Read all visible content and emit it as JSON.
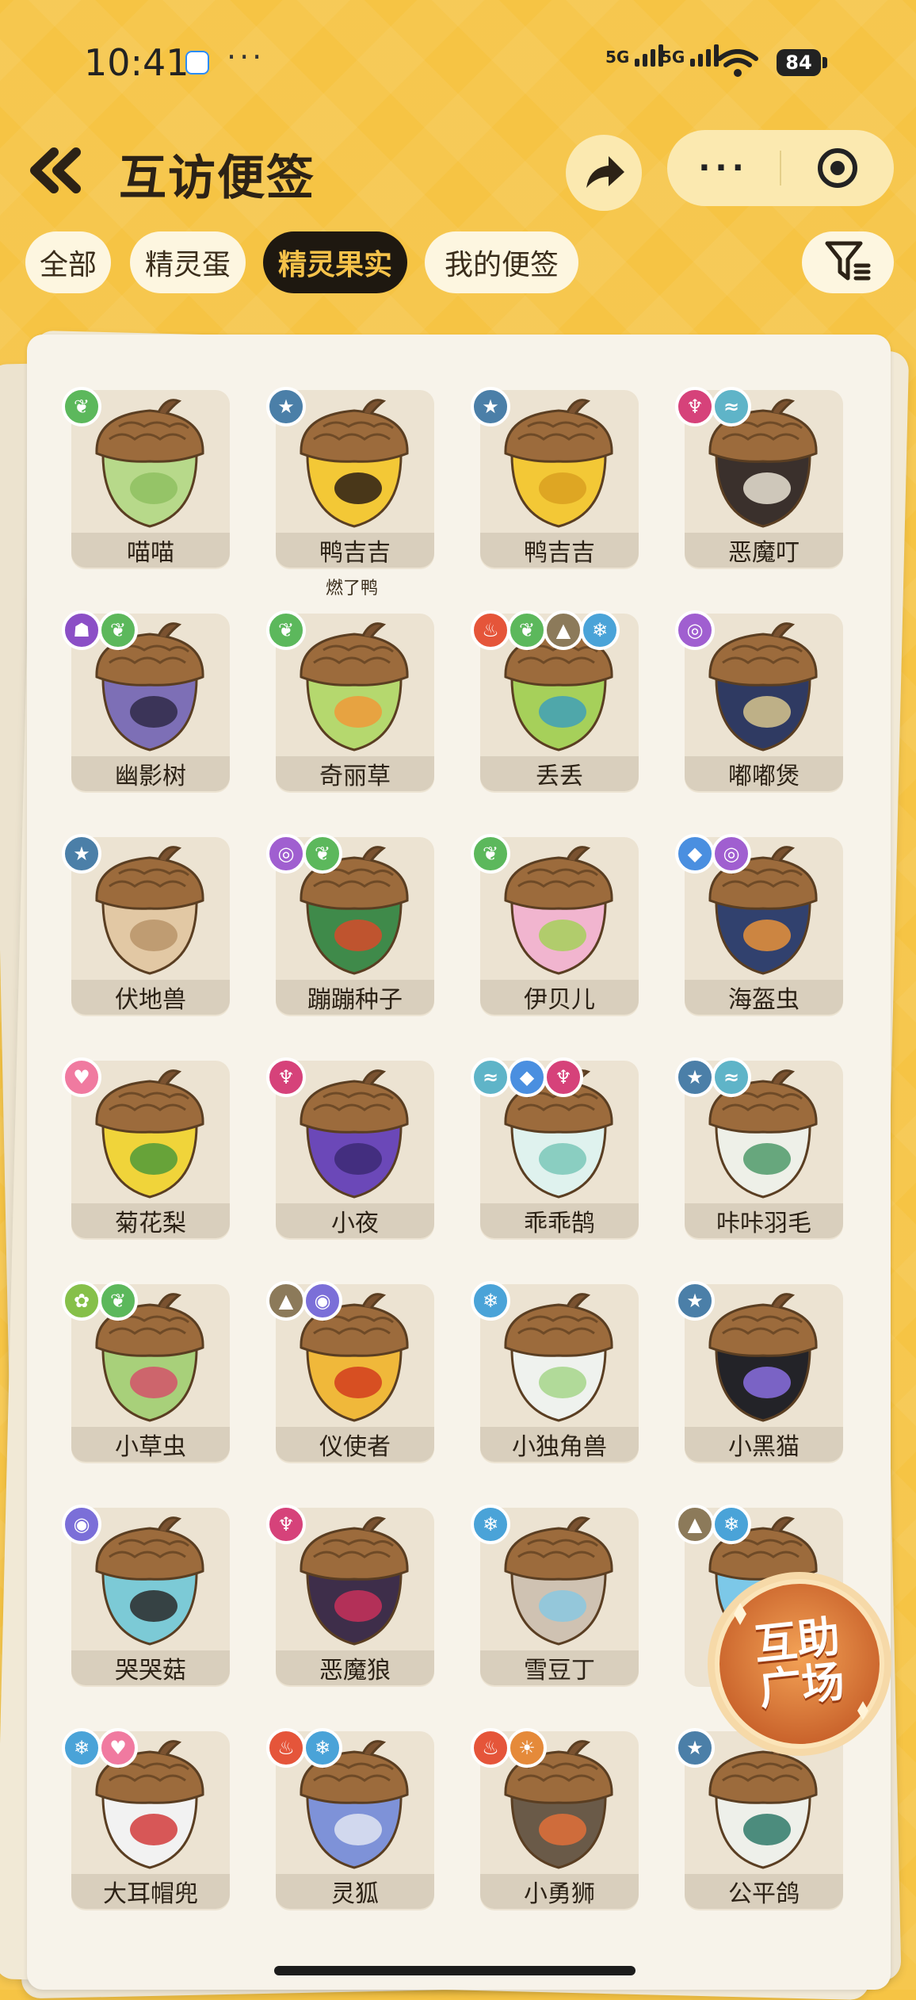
{
  "status": {
    "time": "10:41",
    "dots": "···",
    "net1": "5G",
    "net2": "5G",
    "battery": "84"
  },
  "header": {
    "title": "互访便签",
    "more": "···"
  },
  "tabs": [
    {
      "label": "全部",
      "active": false
    },
    {
      "label": "精灵蛋",
      "active": false
    },
    {
      "label": "精灵果实",
      "active": true
    },
    {
      "label": "我的便签",
      "active": false
    }
  ],
  "colors": {
    "background": "#f6c444",
    "active_tab_bg": "#1e1810",
    "active_tab_text": "#f5c24a",
    "grass": "#5cb85c",
    "normal": "#4b7fa8",
    "demon": "#d6427a",
    "wind": "#5fb4c8",
    "ghost": "#8b4fc6",
    "fire": "#e5553a",
    "ground": "#8c7a5a",
    "ice": "#4aa3d8",
    "psychic": "#a05fd0",
    "water": "#4a8fe0",
    "fairy": "#f07aa0",
    "bug": "#86c04a",
    "dragon": "#7b6fd8",
    "light": "#e58a3a"
  },
  "items": [
    {
      "name": "喵喵",
      "badges": [
        "grass"
      ],
      "colors": [
        "#b7d98a",
        "#8fc060"
      ]
    },
    {
      "name": "鸭吉吉",
      "note": "燃了鸭",
      "badges": [
        "normal"
      ],
      "colors": [
        "#f3c836",
        "#2a1d14"
      ]
    },
    {
      "name": "鸭吉吉",
      "badges": [
        "normal"
      ],
      "colors": [
        "#f3c836",
        "#d9a020"
      ]
    },
    {
      "name": "恶魔叮",
      "badges": [
        "demon",
        "wind"
      ],
      "colors": [
        "#3a302c",
        "#e9e2d4"
      ]
    },
    {
      "name": "幽影树",
      "badges": [
        "ghost",
        "grass"
      ],
      "colors": [
        "#7d6fb6",
        "#2f2a48"
      ]
    },
    {
      "name": "奇丽草",
      "badges": [
        "grass"
      ],
      "colors": [
        "#b5d86e",
        "#f09a3a"
      ]
    },
    {
      "name": "丢丢",
      "badges": [
        "fire",
        "grass",
        "ground",
        "ice"
      ],
      "colors": [
        "#a6d05a",
        "#3fa0b8"
      ]
    },
    {
      "name": "嘟嘟煲",
      "badges": [
        "psychic"
      ],
      "colors": [
        "#2f3a62",
        "#d7c58e"
      ]
    },
    {
      "name": "伏地兽",
      "badges": [
        "normal"
      ],
      "colors": [
        "#e2c8a4",
        "#b8946a"
      ]
    },
    {
      "name": "蹦蹦种子",
      "badges": [
        "psychic",
        "grass"
      ],
      "colors": [
        "#3f8a4a",
        "#d64a2a"
      ]
    },
    {
      "name": "伊贝儿",
      "badges": [
        "grass"
      ],
      "colors": [
        "#f1b5cf",
        "#a6d05a"
      ]
    },
    {
      "name": "海盔虫",
      "badges": [
        "water",
        "psychic"
      ],
      "colors": [
        "#31416e",
        "#e8923a"
      ]
    },
    {
      "name": "菊花梨",
      "badges": [
        "fairy"
      ],
      "colors": [
        "#f0d43a",
        "#4f9a3a"
      ]
    },
    {
      "name": "小夜",
      "badges": [
        "demon"
      ],
      "colors": [
        "#6b48b8",
        "#3c2a74"
      ]
    },
    {
      "name": "乖乖鹄",
      "badges": [
        "wind",
        "water",
        "demon"
      ],
      "colors": [
        "#dff2ee",
        "#7bc8b8"
      ]
    },
    {
      "name": "咔咔羽毛",
      "badges": [
        "normal",
        "wind"
      ],
      "colors": [
        "#eef0e8",
        "#4f9a6a"
      ]
    },
    {
      "name": "小草虫",
      "badges": [
        "bug",
        "grass"
      ],
      "colors": [
        "#a8d07a",
        "#d4526a"
      ]
    },
    {
      "name": "仪使者",
      "badges": [
        "ground",
        "dragon"
      ],
      "colors": [
        "#f0b83a",
        "#d23c1e"
      ]
    },
    {
      "name": "小独角兽",
      "badges": [
        "ice"
      ],
      "colors": [
        "#eff2ee",
        "#a6d68a"
      ]
    },
    {
      "name": "小黑猫",
      "badges": [
        "normal"
      ],
      "colors": [
        "#232328",
        "#8a6fe0"
      ]
    },
    {
      "name": "哭哭菇",
      "badges": [
        "dragon"
      ],
      "colors": [
        "#7ccad6",
        "#2a2a2a"
      ]
    },
    {
      "name": "恶魔狼",
      "badges": [
        "demon"
      ],
      "colors": [
        "#3e2e4a",
        "#c8305a"
      ]
    },
    {
      "name": "雪豆丁",
      "badges": [
        "ice"
      ],
      "colors": [
        "#cfc2b2",
        "#8ac8e0"
      ]
    },
    {
      "name": "",
      "badges": [
        "ground",
        "ice"
      ],
      "colors": [
        "#7cc8e8",
        "#e0e8ee"
      ]
    },
    {
      "name": "大耳帽兜",
      "badges": [
        "ice",
        "fairy"
      ],
      "colors": [
        "#f2f2f2",
        "#d23c3c"
      ]
    },
    {
      "name": "灵狐",
      "badges": [
        "fire",
        "ice"
      ],
      "colors": [
        "#7e92d8",
        "#dfe4f2"
      ]
    },
    {
      "name": "小勇狮",
      "badges": [
        "fire",
        "light"
      ],
      "colors": [
        "#6a5a48",
        "#e0703a"
      ]
    },
    {
      "name": "公平鸽",
      "badges": [
        "normal"
      ],
      "colors": [
        "#eef0ea",
        "#2f7a6a"
      ]
    }
  ],
  "floating": {
    "line1": "互助",
    "line2": "广场"
  }
}
